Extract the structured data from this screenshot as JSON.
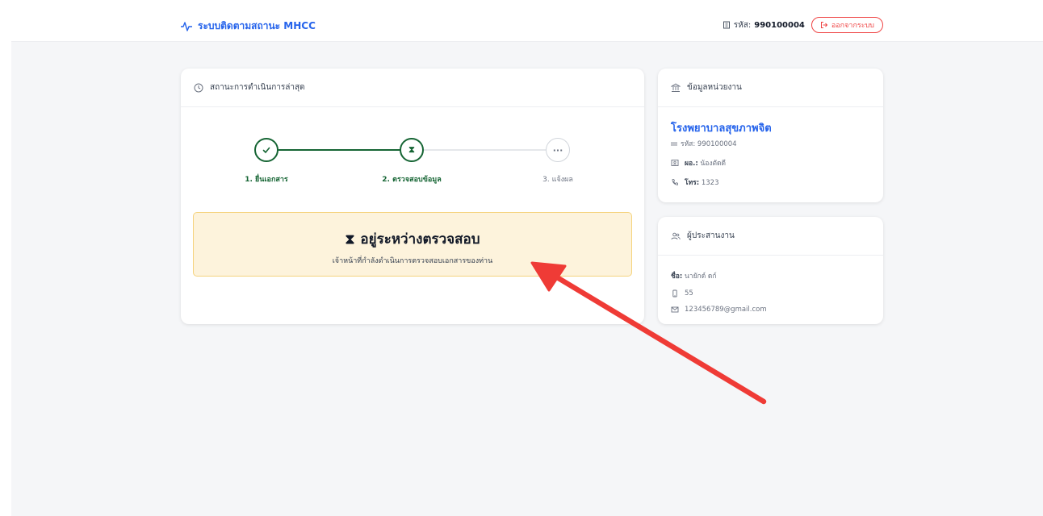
{
  "header": {
    "title": "ระบบติดตามสถานะ MHCC",
    "code_label": "รหัส:",
    "code_value": "990100004",
    "logout_label": "ออกจากระบบ"
  },
  "status_card": {
    "title": "สถานะการดำเนินการล่าสุด",
    "steps": [
      {
        "label": "1. ยื่นเอกสาร",
        "state": "done",
        "icon": "check-icon"
      },
      {
        "label": "2. ตรวจสอบข้อมูล",
        "state": "current",
        "icon": "hourglass-icon",
        "glyph": "⧗"
      },
      {
        "label": "3. แจ้งผล",
        "state": "pending",
        "icon": "ellipsis-icon",
        "glyph": "···"
      }
    ],
    "pending": {
      "icon_glyph": "⧗",
      "title": "อยู่ระหว่างตรวจสอบ",
      "subtitle": "เจ้าหน้าที่กำลังดำเนินการตรวจสอบเอกสารของท่าน"
    }
  },
  "agency_card": {
    "title": "ข้อมูลหน่วยงาน",
    "name": "โรงพยาบาลสุขภาพจิต",
    "code": "รหัส: 990100004",
    "director_label": "ผอ.:",
    "director_value": "น้องตัดดี",
    "phone_label": "โทร:",
    "phone_value": "1323"
  },
  "coordinator_card": {
    "title": "ผู้ประสานงาน",
    "name_label": "ชื่อ:",
    "name_value": "นายักด์ ดก์",
    "mobile": "55",
    "email": "123456789@gmail.com"
  },
  "colors": {
    "brand": "#2563eb",
    "success": "#166534",
    "pending_bg": "#fdf3dc",
    "pending_border": "#f5d37e",
    "danger": "#ef4444",
    "annotation_arrow": "#ef3b36"
  }
}
